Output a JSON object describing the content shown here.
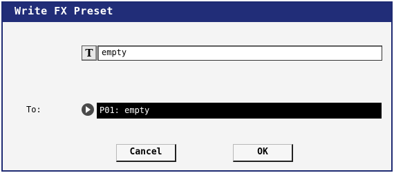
{
  "dialog": {
    "title": "Write FX Preset",
    "name_field": {
      "edit_icon": "T",
      "value": "empty"
    },
    "destination": {
      "label": "To:",
      "value": "P01: empty"
    },
    "buttons": {
      "cancel": "Cancel",
      "ok": "OK"
    }
  },
  "colors": {
    "titlebar": "#212d78",
    "dest_background": "#000000"
  },
  "icons": {
    "text_edit": "text-edit-icon",
    "popup": "popup-arrow-icon"
  }
}
